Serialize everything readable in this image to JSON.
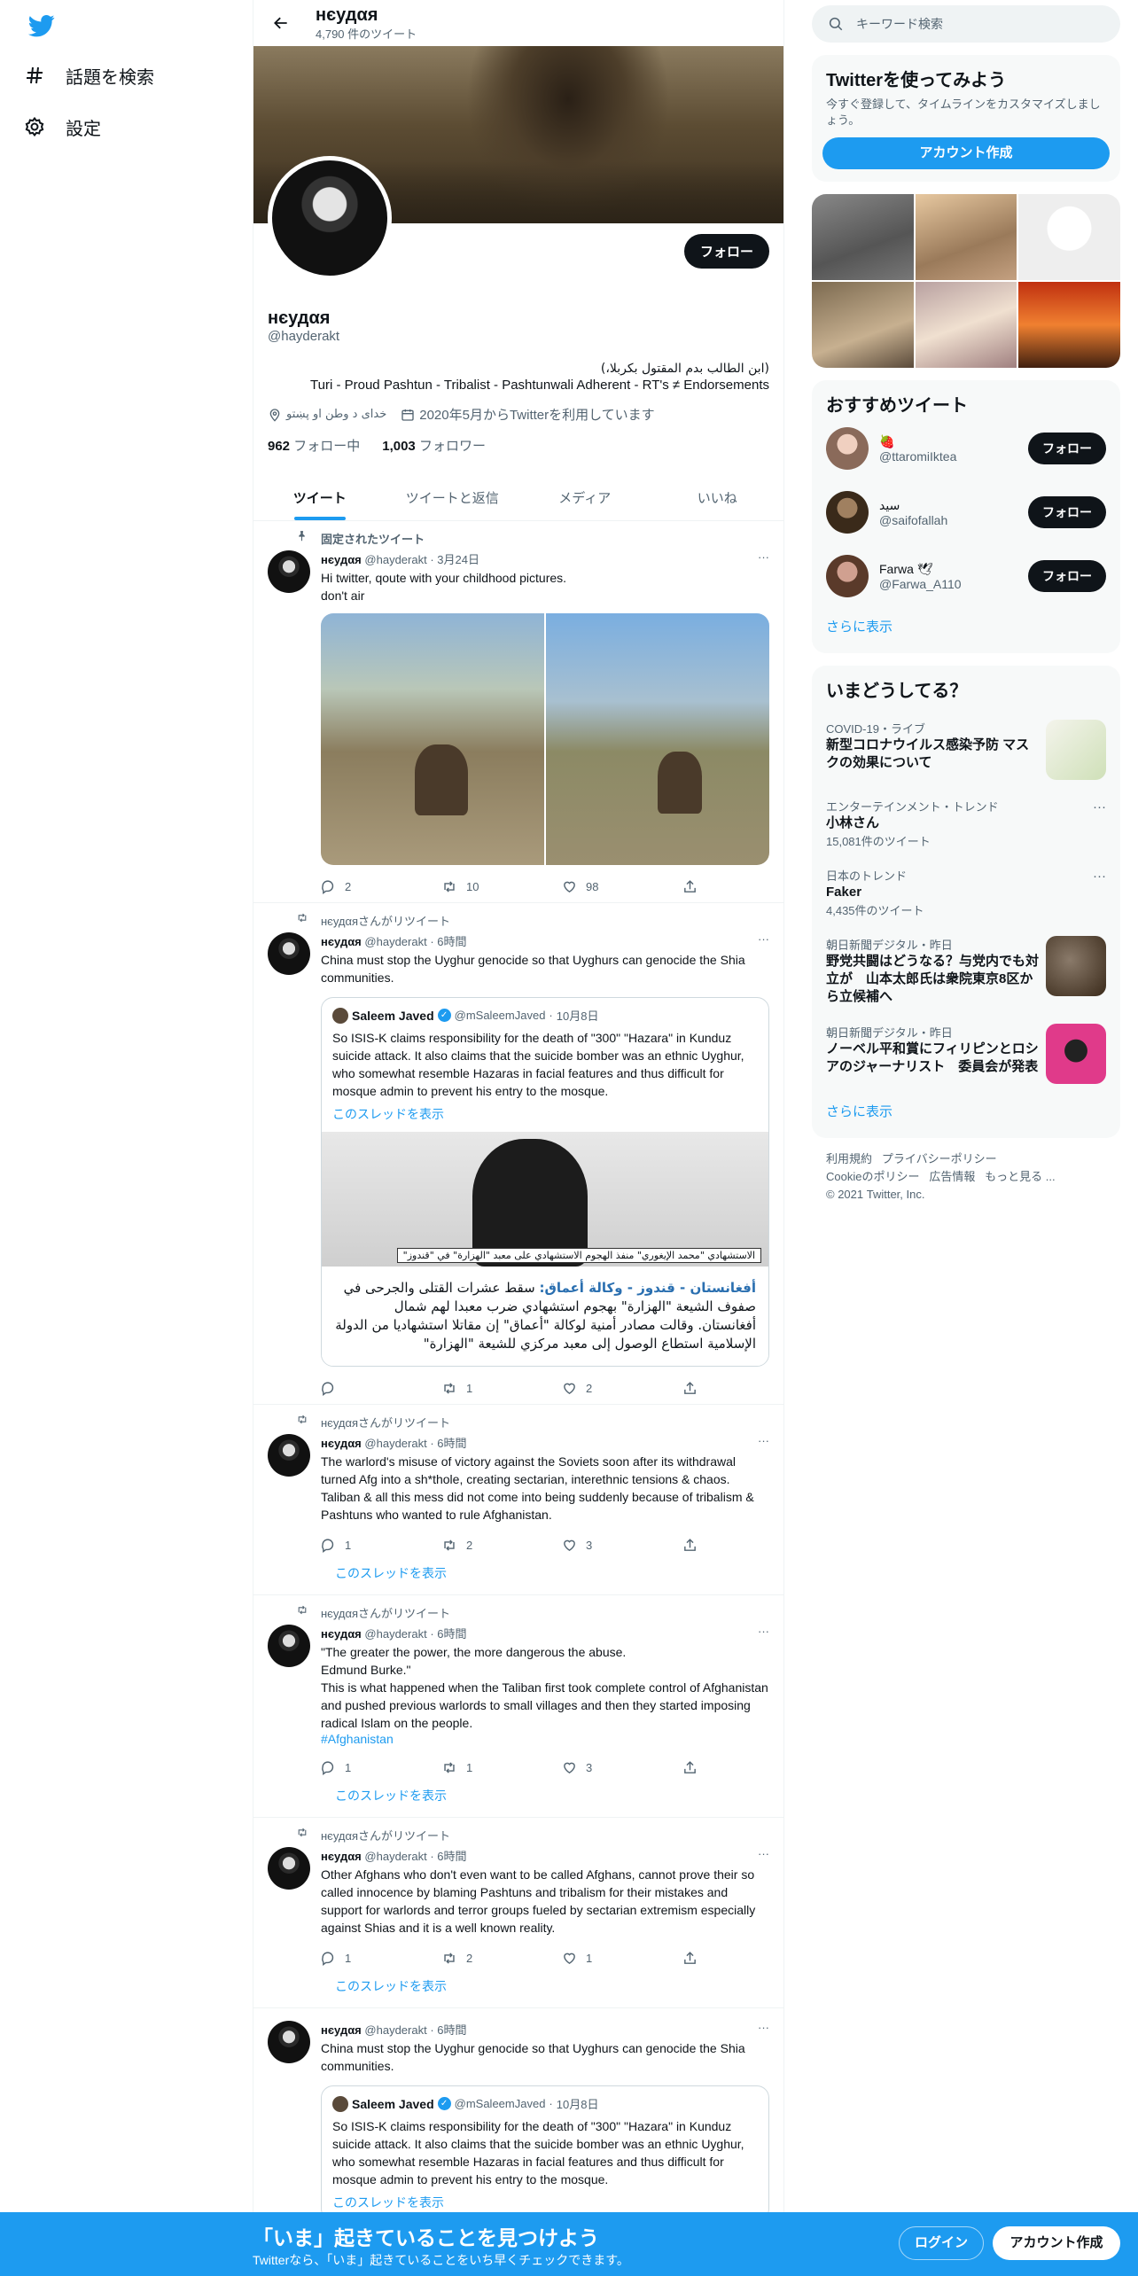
{
  "nav": {
    "items": [
      {
        "label": "話題を検索",
        "icon": "hashtag-icon"
      },
      {
        "label": "設定",
        "icon": "gear-icon"
      }
    ]
  },
  "header": {
    "name": "нєудαя",
    "tweet_count": "4,790 件のツイート"
  },
  "profile": {
    "name": "нєудαя",
    "handle": "@hayderakt",
    "bio_arabic": "(ابن الطالب بدم المقتول بكربلا،)",
    "bio": "Turi - Proud Pashtun - Tribalist - Pashtunwali Adherent - RT's ≠ Endorsements",
    "location": "خدای د وطن او پښتو",
    "joined": "2020年5月からTwitterを利用しています",
    "following_count": "962",
    "following_label": "フォロー中",
    "followers_count": "1,003",
    "followers_label": "フォロワー",
    "follow_button": "フォロー"
  },
  "tabs": [
    "ツイート",
    "ツイートと返信",
    "メディア",
    "いいね"
  ],
  "tweets": [
    {
      "context": "固定されたツイート",
      "name": "нєудαя",
      "handle": "@hayderakt",
      "time": "3月24日",
      "text": "Hi twitter, qoute with your childhood pictures.\ndon't air",
      "replies": "2",
      "retweets": "10",
      "likes": "98"
    },
    {
      "context": "нєудαяさんがリツイート",
      "name": "нєудαя",
      "handle": "@hayderakt",
      "time": "6時間",
      "text": "China must stop the Uyghur genocide so that Uyghurs can genocide the Shia communities.",
      "quote": {
        "name": "Saleem Javed",
        "handle": "@mSaleemJaved",
        "time": "10月8日",
        "text": "So ISIS-K claims responsibility for the death of \"300\" \"Hazara\" in Kunduz suicide attack. It also claims that the suicide bomber was an ethnic Uyghur, who somewhat resemble Hazaras in facial features and thus difficult for mosque admin to prevent his entry to the mosque.",
        "thread_link": "このスレッドを表示",
        "image_caption": "الاستشهادي \"محمد الإيغوري\" منفذ الهجوم الاستشهادي على معبد \"الهزارة\" في \"قندوز\"",
        "arabic_title": "أفغانستان - قندوز - وكالة أعماق:",
        "arabic_text": "سقط عشرات القتلى والجرحى في صفوف الشيعة \"الهزارة\" بهجوم استشهادي ضرب معبدا لهم شمال أفغانستان. وقالت مصادر أمنية لوكالة \"أعماق\" إن مقاتلا استشهاديا من الدولة الإسلامية استطاع الوصول إلى معبد مركزي للشيعة \"الهزارة\""
      },
      "replies": "",
      "retweets": "1",
      "likes": "2"
    },
    {
      "context": "нєудαяさんがリツイート",
      "name": "нєудαя",
      "handle": "@hayderakt",
      "time": "6時間",
      "text": "The warlord's misuse of victory against the Soviets soon after its withdrawal turned Afg into a sh*thole, creating sectarian, interethnic tensions & chaos. Taliban & all this mess did not come into being suddenly because of tribalism & Pashtuns who wanted to rule Afghanistan.",
      "replies": "1",
      "retweets": "2",
      "likes": "3",
      "thread_link": "このスレッドを表示"
    },
    {
      "context": "нєудαяさんがリツイート",
      "name": "нєудαя",
      "handle": "@hayderakt",
      "time": "6時間",
      "text": "\"The greater the power, the more dangerous the abuse.\nEdmund Burke.\"\nThis is what happened when the Taliban first took complete control of Afghanistan and pushed previous warlords to small villages and then they started imposing radical Islam on the people.",
      "hashtag": "#Afghanistan",
      "replies": "1",
      "retweets": "1",
      "likes": "3",
      "thread_link": "このスレッドを表示"
    },
    {
      "context": "нєудαяさんがリツイート",
      "name": "нєудαя",
      "handle": "@hayderakt",
      "time": "6時間",
      "text": "Other Afghans who don't even want to be called Afghans, cannot prove their so called innocence by blaming Pashtuns and tribalism for their mistakes and support for warlords and terror groups fueled by sectarian extremism especially against Shias and it is a well known reality.",
      "replies": "1",
      "retweets": "2",
      "likes": "1",
      "thread_link": "このスレッドを表示"
    },
    {
      "name": "нєудαя",
      "handle": "@hayderakt",
      "time": "6時間",
      "text": "China must stop the Uyghur genocide so that Uyghurs can genocide the Shia communities.",
      "quote": {
        "name": "Saleem Javed",
        "handle": "@mSaleemJaved",
        "time": "10月8日",
        "text": "So ISIS-K claims responsibility for the death of \"300\" \"Hazara\" in Kunduz suicide attack. It also claims that the suicide bomber was an ethnic Uyghur, who somewhat resemble Hazaras in facial features and thus difficult for mosque admin to prevent his entry to the mosque.",
        "thread_link": "このスレッドを表示"
      }
    }
  ],
  "right": {
    "search_placeholder": "キーワード検索",
    "signup_card": {
      "title": "Twitterを使ってみよう",
      "subtitle": "今すぐ登録して、タイムラインをカスタマイズしましょう。",
      "button": "アカウント作成"
    },
    "recommended": {
      "title": "おすすめツイート",
      "users": [
        {
          "name": "🍓",
          "handle": "@ttaromiIktea",
          "button": "フォロー"
        },
        {
          "name": "سید",
          "handle": "@saifofallah",
          "button": "フォロー"
        },
        {
          "name": "Farwa 🕊",
          "handle": "@Farwa_A110",
          "button": "フォロー"
        }
      ],
      "more": "さらに表示"
    },
    "trends": {
      "title": "いまどうしてる？",
      "items": [
        {
          "category": "COVID-19・ライブ",
          "title": "新型コロナウイルス感染予防 マスクの効果について",
          "count": "",
          "thumb": "#d9e8c8"
        },
        {
          "category": "エンターテインメント・トレンド",
          "title": "小林さん",
          "count": "15,081件のツイート"
        },
        {
          "category": "日本のトレンド",
          "title": "Faker",
          "count": "4,435件のツイート"
        },
        {
          "category": "朝日新聞デジタル・昨日",
          "title": "野党共闘はどうなる？与党内でも対立が　山本太郎氏は衆院東京8区から立候補へ",
          "count": "",
          "thumb": "#6a5a4a"
        },
        {
          "category": "朝日新聞デジタル・昨日",
          "title": "ノーベル平和賞にフィリピンとロシアのジャーナリスト　委員会が発表",
          "count": "",
          "thumb": "#c8307a"
        }
      ],
      "more": "さらに表示"
    },
    "footer": {
      "links": [
        "利用規約",
        "プライバシーポリシー",
        "Cookieのポリシー",
        "広告情報",
        "もっと見る ..."
      ],
      "copyright": "© 2021 Twitter, Inc."
    }
  },
  "bottom_banner": {
    "title": "「いま」起きていることを見つけよう",
    "subtitle": "Twitterなら、「いま」起きていることをいち早くチェックできます。",
    "login": "ログイン",
    "signup": "アカウント作成"
  },
  "colors": {
    "accent": "#1d9bf0",
    "text": "#0f1419",
    "muted": "#536471"
  }
}
